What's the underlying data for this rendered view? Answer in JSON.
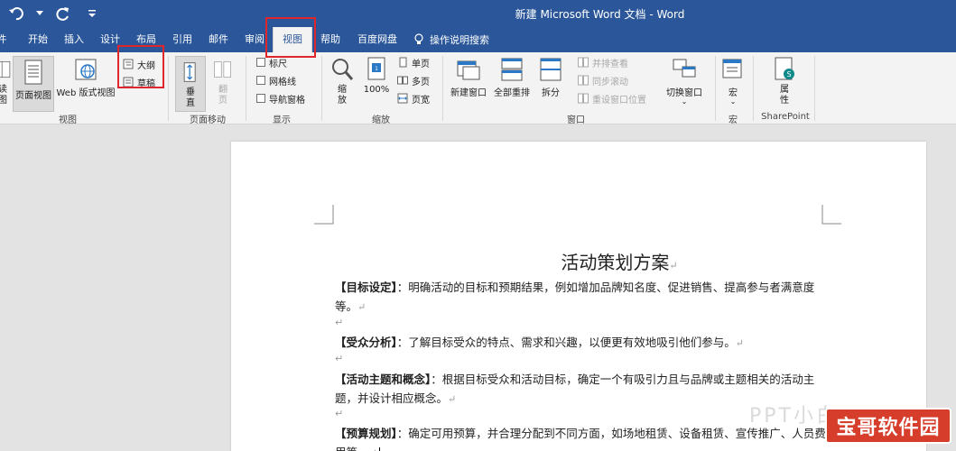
{
  "window": {
    "title": "新建 Microsoft Word 文档  -  Word"
  },
  "qat": {
    "undo_icon": "undo-icon",
    "redo_icon": "redo-icon",
    "customize_icon": "customize-qat-icon"
  },
  "tabs": [
    {
      "label": "件"
    },
    {
      "label": "开始"
    },
    {
      "label": "插入"
    },
    {
      "label": "设计"
    },
    {
      "label": "布局"
    },
    {
      "label": "引用"
    },
    {
      "label": "邮件"
    },
    {
      "label": "审阅"
    },
    {
      "label": "视图",
      "active": true
    },
    {
      "label": "帮助"
    },
    {
      "label": "百度网盘"
    }
  ],
  "tellme": {
    "label": "操作说明搜索"
  },
  "ribbon": {
    "views": {
      "label": "视图",
      "read_mode": "读\n图",
      "print_layout": "页面视图",
      "web_layout": "Web 版式视图",
      "outline": "大纲",
      "draft": "草稿"
    },
    "page_movement": {
      "label": "页面移动",
      "vertical": "垂\n直",
      "side_to_side": "翻\n页"
    },
    "show": {
      "label": "显示",
      "ruler": "标尺",
      "gridlines": "网格线",
      "nav_pane": "导航窗格"
    },
    "zoom": {
      "label": "缩放",
      "zoom": "缩\n放",
      "zoom100": "100%",
      "one_page": "单页",
      "multi_page": "多页",
      "page_width": "页宽"
    },
    "window": {
      "label": "窗口",
      "new_window": "新建窗口",
      "arrange_all": "全部重排",
      "split": "拆分",
      "side_by_side": "并排查看",
      "sync_scroll": "同步滚动",
      "reset_pos": "重设窗口位置",
      "switch_windows": "切换窗口"
    },
    "macros": {
      "label": "宏",
      "macros": "宏"
    },
    "sharepoint": {
      "label": "SharePoint",
      "properties": "属\n性"
    }
  },
  "document": {
    "title": "活动策划方案",
    "paragraphs": [
      {
        "head": "【目标设定】",
        "body": "：明确活动的目标和预期结果，例如增加品牌知名度、促进销售、提高参与者满意度等。"
      },
      {
        "head": "【受众分析】",
        "body": "：了解目标受众的特点、需求和兴趣，以便更有效地吸引他们参与。"
      },
      {
        "head": "【活动主题和概念】",
        "body": "：根据目标受众和活动目标，确定一个有吸引力且与品牌或主题相关的活动主题，并设计相应概念。"
      },
      {
        "head": "【预算规划】",
        "body": "：确定可用预算，并合理分配到不同方面，如场地租赁、设备租赁、宣传推广、人员费用等。"
      }
    ],
    "return_mark": "↵"
  },
  "watermark": {
    "faint": "PPT小白",
    "badge": "宝哥软件园"
  },
  "colors": {
    "ribbon_blue": "#2b579a",
    "highlight_red": "#e0262a",
    "badge_red": "#d63d2a"
  }
}
